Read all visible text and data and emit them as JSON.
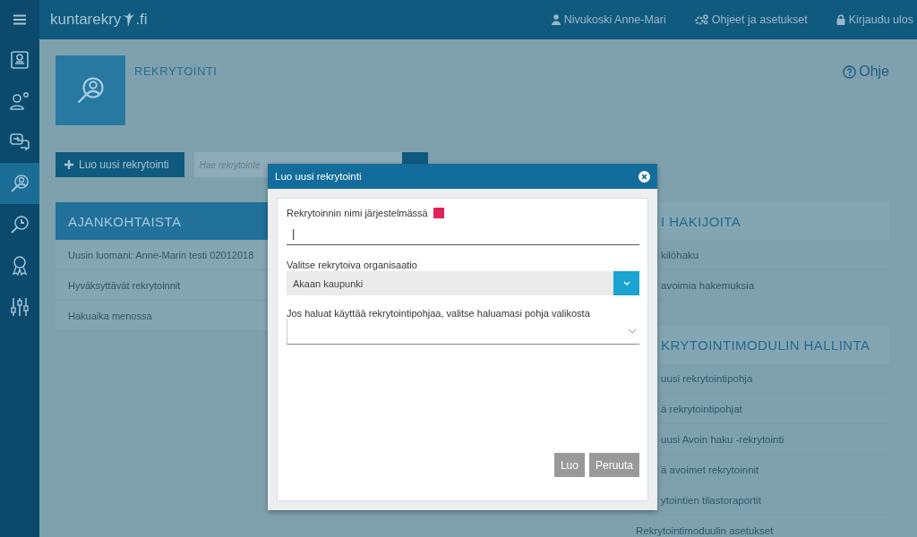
{
  "topbar": {
    "logo": "kuntarekry",
    "logo_suffix": ".fi",
    "links": [
      {
        "kind": "user",
        "label": "Nivukoski Anne-Mari"
      },
      {
        "kind": "settings",
        "label": "Ohjeet ja asetukset"
      },
      {
        "kind": "logout",
        "label": "Kirjaudu ulos"
      }
    ]
  },
  "sidebar": {
    "items": [
      {
        "kind": "idcard",
        "selected": false
      },
      {
        "kind": "personpin",
        "selected": false
      },
      {
        "kind": "chat",
        "selected": false
      },
      {
        "kind": "search",
        "selected": true
      },
      {
        "kind": "clock",
        "selected": false
      },
      {
        "kind": "award",
        "selected": false
      },
      {
        "kind": "sliders",
        "selected": false
      }
    ]
  },
  "page": {
    "title": "REKRYTOINTI",
    "help": "Ohje"
  },
  "toolbar": {
    "new_button": "Luo uusi rekrytointi",
    "search_placeholder": "Hae rekrytointe"
  },
  "left_panel": {
    "title": "AJANKOHTAISTA",
    "items": [
      "Uusin luomani: Anne-Marin testi 02012018",
      "Hyväksyttävät rekrytoinnit",
      "Hakuaika menossa"
    ]
  },
  "right_panels": [
    {
      "title": "I HAKIJOITA",
      "items": [
        {
          "label": "kilöhaku",
          "kind": "cut"
        },
        {
          "label": "avoimia hakemuksia",
          "kind": "cut"
        }
      ]
    },
    {
      "title": "KRYTOINTIMODULIN HALLINTA",
      "items": [
        {
          "label": "uusi rekrytointipohja",
          "kind": "cut"
        },
        {
          "label": "ä rekrytointipohjat",
          "kind": "cut"
        },
        {
          "label": "uusi Avoin haku -rekrytointi",
          "kind": "cut"
        },
        {
          "label": "ä avoimet rekrytoinnit",
          "kind": "cut"
        },
        {
          "label": "ytointien tilastoraportit",
          "kind": "cut"
        },
        {
          "label": "Rekrytointimoduulin asetukset",
          "kind": "full"
        }
      ]
    }
  ],
  "dialog": {
    "title": "Luo uusi rekrytointi",
    "fields": [
      {
        "kind": "text",
        "label": "Rekrytoinnin nimi järjestelmässä",
        "required": true,
        "value": "|"
      },
      {
        "kind": "select",
        "label": "Valitse rekrytoiva organisaatio",
        "value": "Akaan kaupunki"
      },
      {
        "kind": "dropdown",
        "label": "Jos haluat käyttää rekrytointipohjaa, valitse haluamasi pohja valikosta"
      }
    ],
    "buttons": [
      "Luo",
      "Peruuta"
    ]
  }
}
